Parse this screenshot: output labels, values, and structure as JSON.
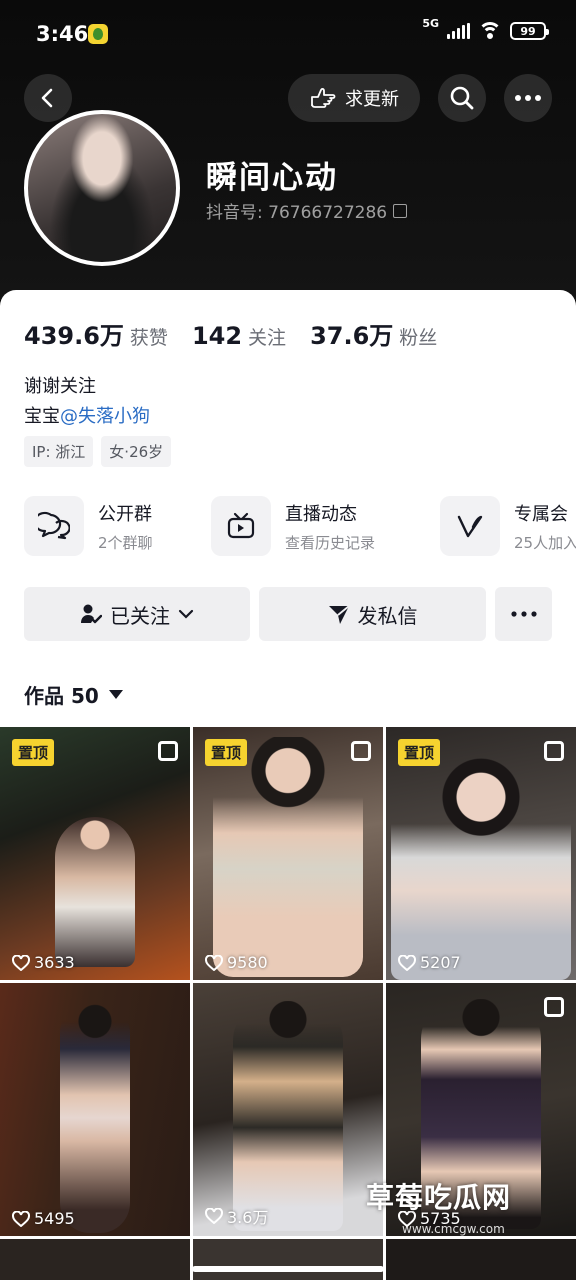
{
  "status_bar": {
    "time": "3:46",
    "network": "5G",
    "battery": "99"
  },
  "header": {
    "update_label": "求更新"
  },
  "profile": {
    "nickname": "瞬间心动",
    "douyin_id": "抖音号: 76766727286"
  },
  "stats": [
    {
      "num": "439.6万",
      "label": "获赞"
    },
    {
      "num": "142",
      "label": "关注"
    },
    {
      "num": "37.6万",
      "label": "粉丝"
    }
  ],
  "bio": {
    "line1": "谢谢关注",
    "line2_prefix": "宝宝",
    "mention": "@失落小狗"
  },
  "tags": [
    "IP: 浙江",
    "女·26岁"
  ],
  "features": [
    {
      "title": "公开群",
      "sub": "2个群聊",
      "icon": "chat-bubbles-icon"
    },
    {
      "title": "直播动态",
      "sub": "查看历史记录",
      "icon": "tv-icon"
    },
    {
      "title": "专属会",
      "sub": "25人加入",
      "icon": "v-badge-icon"
    }
  ],
  "actions": {
    "followed": "已关注",
    "message": "发私信"
  },
  "works": {
    "label": "作品 50"
  },
  "grid": [
    {
      "pin": "置顶",
      "likes": "3633"
    },
    {
      "pin": "置顶",
      "likes": "9580"
    },
    {
      "pin": "置顶",
      "likes": "5207"
    },
    {
      "pin": "",
      "likes": "5495"
    },
    {
      "pin": "",
      "likes": "3.6万"
    },
    {
      "pin": "",
      "likes": "5735"
    }
  ],
  "watermark": {
    "title": "草莓吃瓜网",
    "url": "www.cmcgw.com"
  },
  "colors": {
    "mention": "#2a6cc4",
    "pin_badge": "#f6d32f",
    "header_bg": "#0a0a0a"
  }
}
